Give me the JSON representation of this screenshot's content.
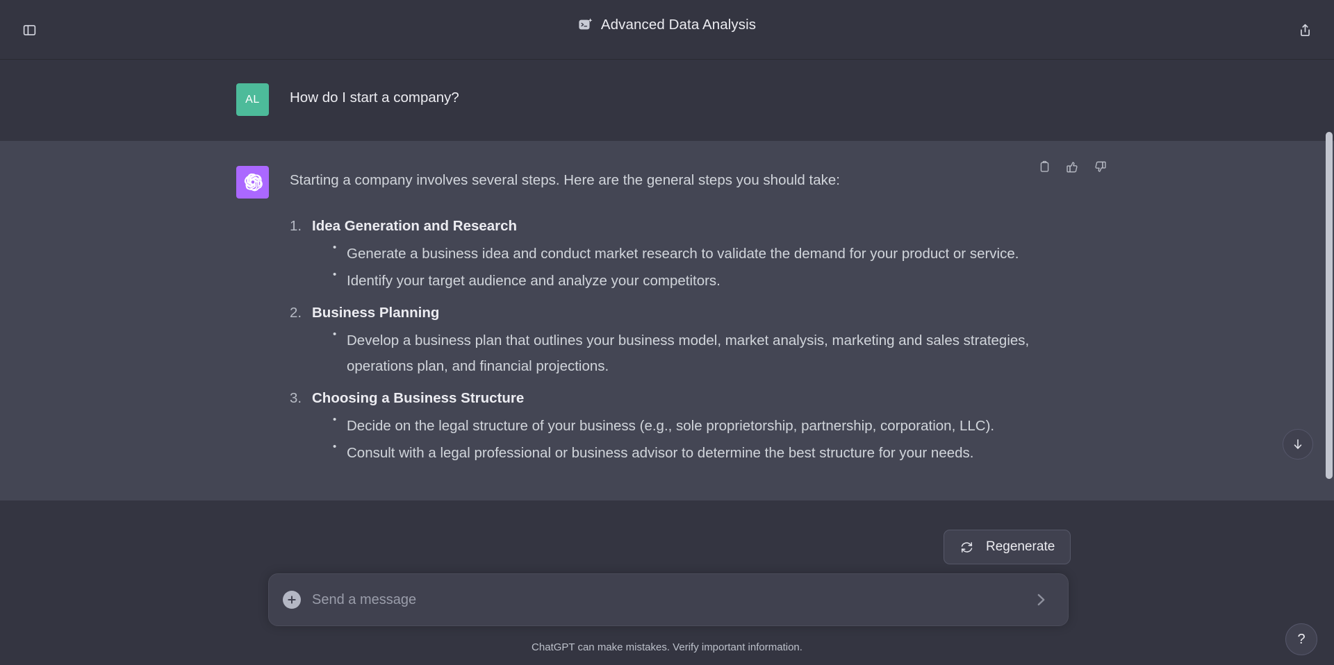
{
  "header": {
    "title": "Advanced Data Analysis",
    "mode_icon": "terminal-sparkle-icon",
    "sidebar_toggle_icon": "sidebar-panel-icon",
    "share_icon": "share-upload-icon"
  },
  "conversation": [
    {
      "role": "user",
      "avatar_initials": "AL",
      "avatar_color": "#4dbb9a",
      "text": "How do I start a company?"
    },
    {
      "role": "assistant",
      "avatar_icon": "openai-logo-icon",
      "avatar_color": "#ab68ff",
      "intro": "Starting a company involves several steps. Here are the general steps you should take:",
      "steps": [
        {
          "title": "Idea Generation and Research",
          "bullets": [
            "Generate a business idea and conduct market research to validate the demand for your product or service.",
            "Identify your target audience and analyze your competitors."
          ]
        },
        {
          "title": "Business Planning",
          "bullets": [
            "Develop a business plan that outlines your business model, market analysis, marketing and sales strategies, operations plan, and financial projections."
          ]
        },
        {
          "title": "Choosing a Business Structure",
          "bullets": [
            "Decide on the legal structure of your business (e.g., sole proprietorship, partnership, corporation, LLC).",
            "Consult with a legal professional or business advisor to determine the best structure for your needs."
          ]
        }
      ],
      "actions": [
        {
          "name": "copy",
          "icon": "clipboard-icon"
        },
        {
          "name": "like",
          "icon": "thumbs-up-icon"
        },
        {
          "name": "dislike",
          "icon": "thumbs-down-icon"
        }
      ]
    }
  ],
  "composer": {
    "placeholder": "Send a message",
    "value": "",
    "attach_icon": "plus-circle-icon",
    "send_icon": "send-arrow-icon"
  },
  "regenerate": {
    "label": "Regenerate",
    "icon": "refresh-icon"
  },
  "footer": {
    "disclaimer": "ChatGPT can make mistakes. Verify important information."
  },
  "floating": {
    "scroll_down_icon": "arrow-down-icon",
    "help_label": "?"
  }
}
